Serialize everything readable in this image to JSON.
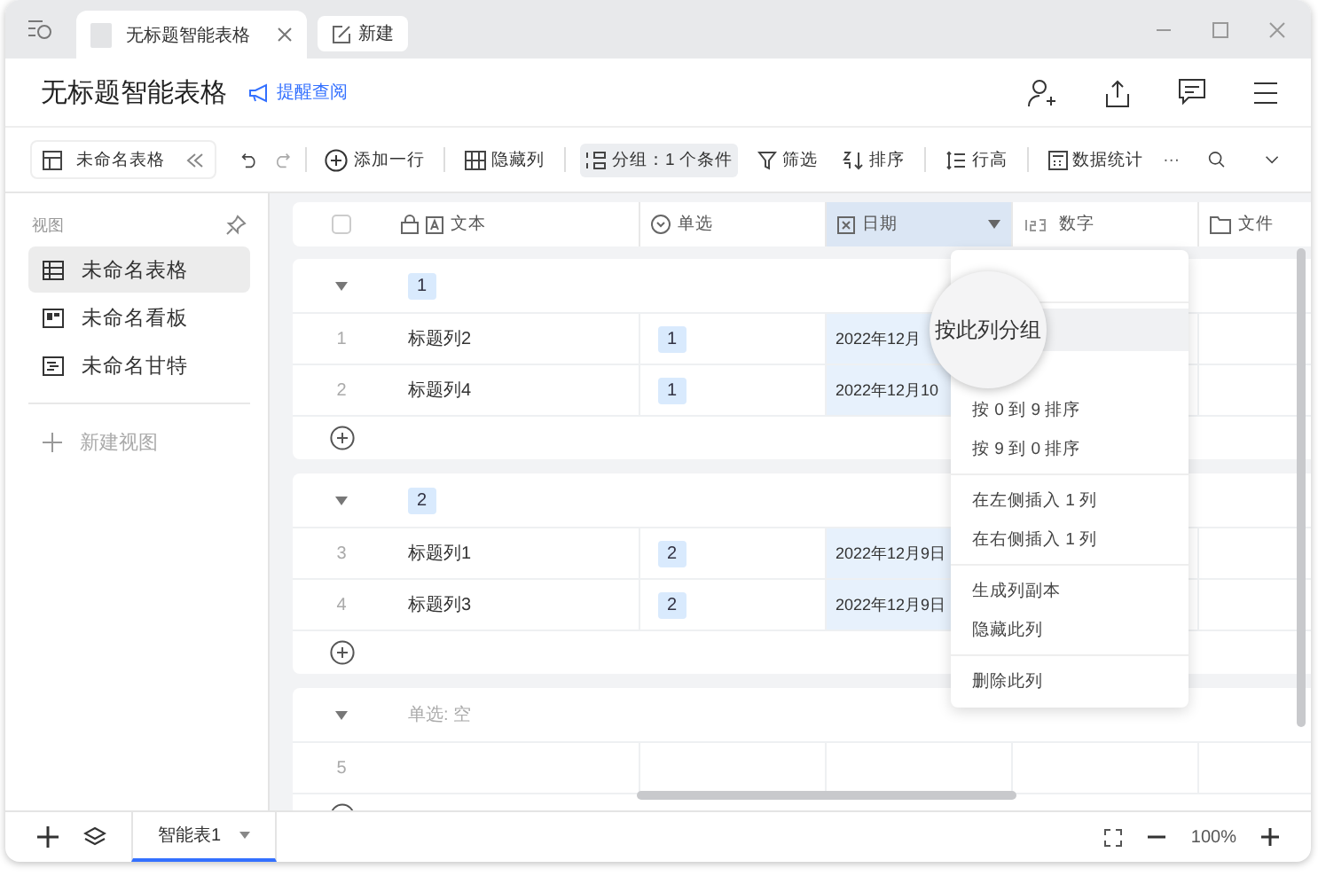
{
  "window": {
    "tabs": [
      {
        "label": "无标题智能表格",
        "selected": true,
        "kind": "doc"
      },
      {
        "label": "新建",
        "selected": false,
        "kind": "new"
      }
    ]
  },
  "header": {
    "title": "无标题智能表格",
    "remind": "提醒查阅"
  },
  "toolbar": {
    "view": "未命名表格",
    "items": [
      {
        "label": "添加一行",
        "kind": "add",
        "selected": false
      },
      {
        "label": "隐藏列",
        "kind": "hide",
        "selected": false
      },
      {
        "label": "分组：1 个条件",
        "kind": "group",
        "selected": true
      },
      {
        "label": "筛选",
        "kind": "filter",
        "selected": false
      },
      {
        "label": "排序",
        "kind": "sort",
        "selected": false
      },
      {
        "label": "行高",
        "kind": "height",
        "selected": false
      },
      {
        "label": "数据统计",
        "kind": "stats",
        "selected": false
      }
    ],
    "more": "···"
  },
  "sidebar": {
    "heading": "视图",
    "views": [
      {
        "label": "未命名表格",
        "kind": "grid",
        "selected": true
      },
      {
        "label": "未命名看板",
        "kind": "kanban",
        "selected": false
      },
      {
        "label": "未命名甘特",
        "kind": "gantt",
        "selected": false
      }
    ],
    "new_view": "新建视图"
  },
  "table": {
    "select_all": {
      "checked": false
    },
    "columns": [
      {
        "label": "文本",
        "kind": "text",
        "selected": false
      },
      {
        "label": "单选",
        "kind": "select",
        "selected": false
      },
      {
        "label": "日期",
        "kind": "date",
        "selected": true
      },
      {
        "label": "数字",
        "kind": "number",
        "selected": false
      },
      {
        "label": "文件",
        "kind": "file",
        "selected": false
      }
    ],
    "groups": [
      {
        "label": "1",
        "empty": false,
        "rows": [
          {
            "num": "1",
            "text": "标题列2",
            "select": "1",
            "date": "2022年12月"
          },
          {
            "num": "2",
            "text": "标题列4",
            "select": "1",
            "date": "2022年12月10"
          }
        ]
      },
      {
        "label": "2",
        "empty": false,
        "rows": [
          {
            "num": "3",
            "text": "标题列1",
            "select": "2",
            "date": "2022年12月9日"
          },
          {
            "num": "4",
            "text": "标题列3",
            "select": "2",
            "date": "2022年12月9日"
          }
        ]
      },
      {
        "label": "单选: 空",
        "empty": true,
        "rows": [
          {
            "num": "5"
          }
        ]
      }
    ]
  },
  "menu": {
    "sections": [
      [
        {
          "kind": "covered"
        }
      ],
      [
        {
          "label": "按此列分组",
          "kind": "lens"
        },
        {
          "kind": "covered"
        },
        {
          "label": "按 0 到 9 排序",
          "kind": "item"
        },
        {
          "label": "按 9 到 0 排序",
          "kind": "item"
        }
      ],
      [
        {
          "label": "在左侧插入 1 列",
          "kind": "item"
        },
        {
          "label": "在右侧插入 1 列",
          "kind": "item"
        }
      ],
      [
        {
          "label": "生成列副本",
          "kind": "item"
        },
        {
          "label": "隐藏此列",
          "kind": "item"
        }
      ],
      [
        {
          "label": "删除此列",
          "kind": "item"
        }
      ]
    ]
  },
  "footer": {
    "sheets": [
      {
        "label": "智能表1",
        "selected": true
      }
    ],
    "zoom": "100%"
  }
}
